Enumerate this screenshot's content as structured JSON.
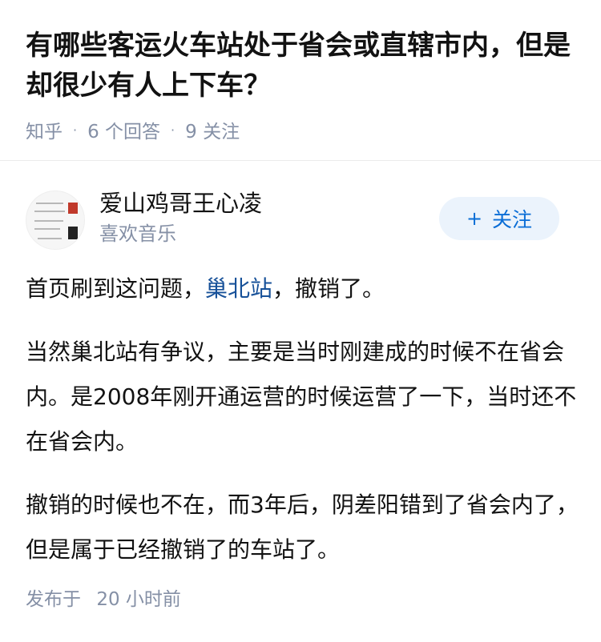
{
  "question": {
    "title": "有哪些客运火车站处于省会或直辖市内，但是却很少有人上下车？",
    "source": "知乎",
    "answers": "6 个回答",
    "followers": "9 关注"
  },
  "author": {
    "name": "爱山鸡哥王心凌",
    "bio": "喜欢音乐",
    "follow_label": "关注",
    "follow_plus": "+"
  },
  "answer": {
    "p1_before": "首页刷到这问题，",
    "p1_link": "巢北站",
    "p1_after": "，撤销了。",
    "p2": "当然巢北站有争议，主要是当时刚建成的时候不在省会内。是2008年刚开通运营的时候运营了一下，当时还不在省会内。",
    "p3": "撤销的时候也不在，而3年后，阴差阳错到了省会内了，但是属于已经撤销了的车站了。"
  },
  "footer": {
    "published_label": "发布于",
    "published_time": "20 小时前"
  },
  "colors": {
    "link": "#175199",
    "follow_bg": "#ebf3fc",
    "follow_text": "#0a6dd6",
    "meta": "#8590a6"
  }
}
